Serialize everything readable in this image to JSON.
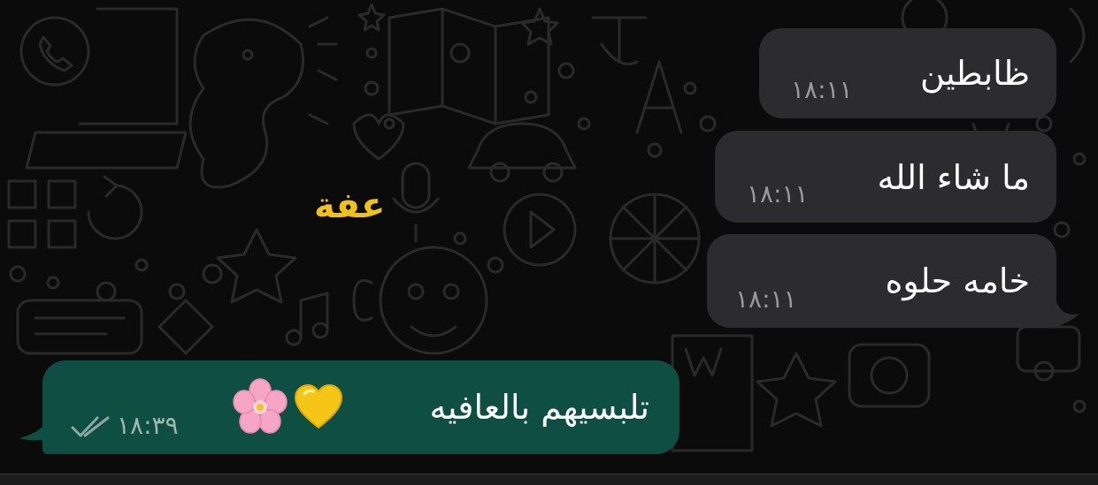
{
  "messages": [
    {
      "text": "ظابطين",
      "time": "١٨:١١",
      "direction": "incoming"
    },
    {
      "text": "ما شاء الله",
      "time": "١٨:١١",
      "direction": "incoming"
    },
    {
      "text": "خامه حلوه",
      "time": "١٨:١١",
      "direction": "incoming"
    },
    {
      "text": "تلبسيهم بالعافيه",
      "time": "١٨:٣٩",
      "direction": "outgoing",
      "emojis": [
        "yellow-heart",
        "cherry-blossom"
      ],
      "read_status": "read"
    }
  ],
  "sticker": {
    "text": "عفة",
    "color": "#f0c11a"
  },
  "colors": {
    "background": "#0b0b0b",
    "incoming_bubble": "#2c2c2e",
    "outgoing_bubble": "#0f4f43",
    "timestamp": "#9a9a9a",
    "read_ticks": "#8ea8a1"
  }
}
